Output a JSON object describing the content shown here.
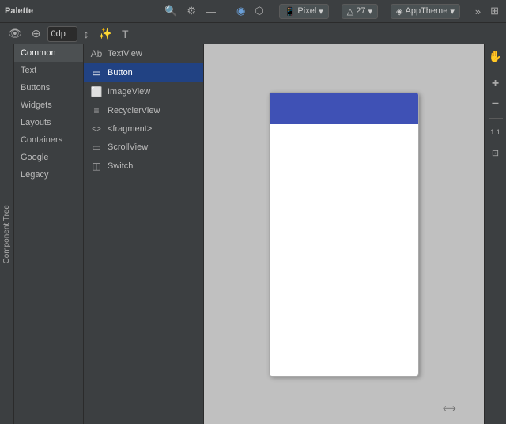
{
  "palette": {
    "title": "Palette",
    "search_icon": "🔍",
    "settings_icon": "⚙",
    "minimize_icon": "—"
  },
  "toolbar": {
    "design_icon": "◉",
    "blueprint_icon": "⬡",
    "pixel_label": "Pixel",
    "api_level": "27",
    "theme_label": "AppTheme",
    "overflow_icon": "»",
    "extras_icon": "⊞"
  },
  "design_tools": {
    "view_icon": "👁",
    "magnet_icon": "⊕",
    "margin_value": "0dp",
    "transform_icon": "↕",
    "magic_icon": "✨",
    "text_icon": "T"
  },
  "categories": [
    {
      "id": "common",
      "label": "Common",
      "active": true
    },
    {
      "id": "text",
      "label": "Text",
      "active": false
    },
    {
      "id": "buttons",
      "label": "Buttons",
      "active": false
    },
    {
      "id": "widgets",
      "label": "Widgets",
      "active": false
    },
    {
      "id": "layouts",
      "label": "Layouts",
      "active": false
    },
    {
      "id": "containers",
      "label": "Containers",
      "active": false
    },
    {
      "id": "google",
      "label": "Google",
      "active": false
    },
    {
      "id": "legacy",
      "label": "Legacy",
      "active": false
    }
  ],
  "widgets": [
    {
      "id": "textview",
      "label": "TextView",
      "icon": "Ab",
      "selected": false
    },
    {
      "id": "button",
      "label": "Button",
      "icon": "▭",
      "selected": true
    },
    {
      "id": "imageview",
      "label": "ImageView",
      "icon": "⬜",
      "selected": false
    },
    {
      "id": "recyclerview",
      "label": "RecyclerView",
      "icon": "≡",
      "selected": false
    },
    {
      "id": "fragment",
      "label": "<fragment>",
      "icon": "<>",
      "selected": false
    },
    {
      "id": "scrollview",
      "label": "ScrollView",
      "icon": "▭",
      "selected": false
    },
    {
      "id": "switch",
      "label": "Switch",
      "icon": "◫",
      "selected": false
    }
  ],
  "device": {
    "name": "Pixel",
    "api": "27",
    "theme": "AppTheme"
  },
  "canvas": {
    "phone_header_color": "#3f51b5",
    "zoom_label": "1:1"
  },
  "right_tools": [
    {
      "id": "hand",
      "icon": "✋"
    },
    {
      "id": "zoom-in",
      "icon": "+"
    },
    {
      "id": "zoom-out",
      "icon": "−"
    },
    {
      "id": "zoom-reset",
      "icon": "1:1"
    },
    {
      "id": "fit",
      "icon": "⊡"
    }
  ],
  "side_label": "Component Tree"
}
